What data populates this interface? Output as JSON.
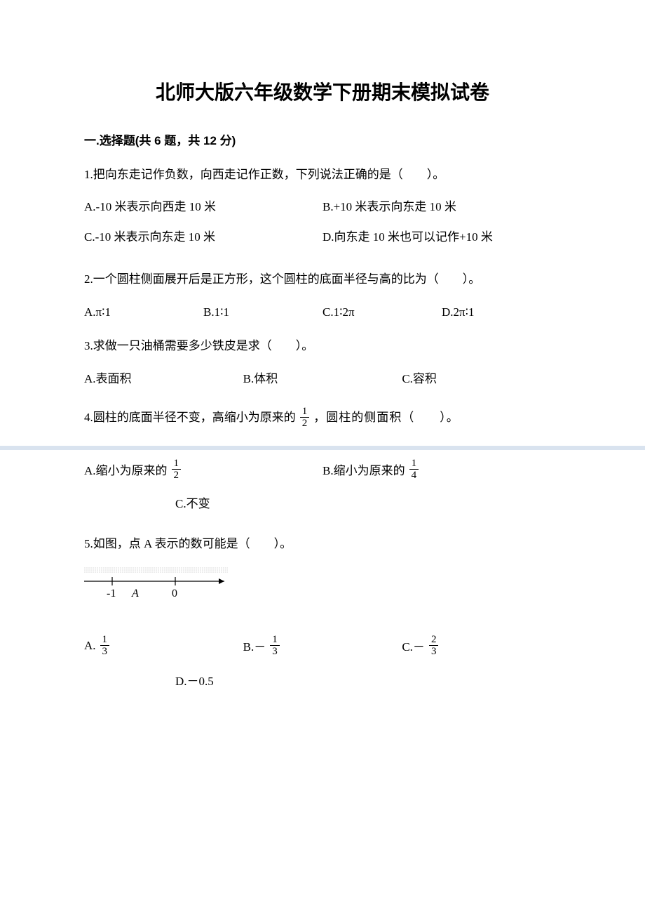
{
  "title": "北师大版六年级数学下册期末模拟试卷",
  "section1": {
    "header": "一.选择题(共 6 题，共 12 分)"
  },
  "q1": {
    "text": "1.把向东走记作负数，向西走记作正数，下列说法正确的是（　　）。",
    "A": "A.-10 米表示向西走 10 米",
    "B": "B.+10 米表示向东走 10 米",
    "C": "C.-10 米表示向东走 10 米",
    "D": "D.向东走 10 米也可以记作+10 米"
  },
  "q2": {
    "text": "2.一个圆柱侧面展开后是正方形，这个圆柱的底面半径与高的比为（　　）。",
    "A": "A.π∶1",
    "B": "B.1∶1",
    "C": "C.1∶2π",
    "D": "D.2π∶1"
  },
  "q3": {
    "text": "3.求做一只油桶需要多少铁皮是求（　　）。",
    "A": "A.表面积",
    "B": "B.体积",
    "C": "C.容积"
  },
  "q4": {
    "pre": "4.圆柱的底面半径不变，高缩小为原来的",
    "post": "，圆柱的侧面积（　　）。",
    "Apre": "A.缩小为原来的",
    "Bpre": "B.缩小为原来的",
    "C": "C.不变",
    "f1n": "1",
    "f1d": "2",
    "f2n": "1",
    "f2d": "2",
    "f3n": "1",
    "f3d": "4"
  },
  "q5": {
    "text": "5.如图，点 A 表示的数可能是（　　）。",
    "Apre": "A.",
    "Bpre": "B.－",
    "Cpre": "C.－",
    "D": "D.－0.5",
    "f1n": "1",
    "f1d": "3",
    "f2n": "1",
    "f2d": "3",
    "f3n": "2",
    "f3d": "3",
    "nl_minus1": "-1",
    "nl_A": "A",
    "nl_zero": "0"
  }
}
